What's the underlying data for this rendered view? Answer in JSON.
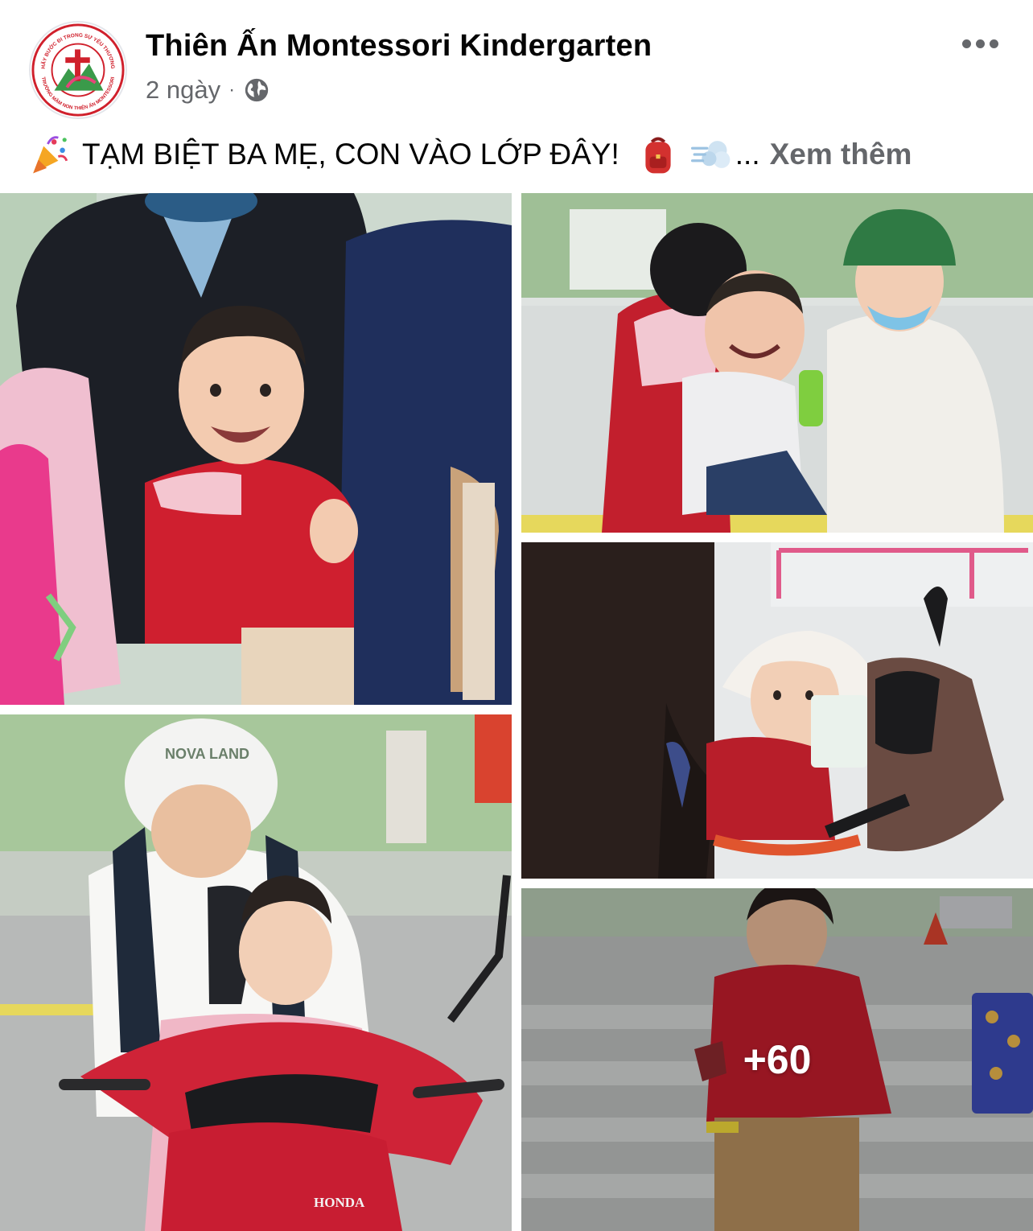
{
  "header": {
    "page_name": "Thiên Ấn Montessori Kindergarten",
    "timestamp": "2 ngày",
    "separator": "·",
    "privacy_icon": "globe-icon",
    "more_icon": "more-options-icon"
  },
  "avatar": {
    "logo_top_text": "HÃY BƯỚC ĐI TRONG SỰ YÊU THƯƠNG",
    "logo_bottom_text": "TRƯỜNG MẦM NON THIÊN ẤN MONTESSORI"
  },
  "caption": {
    "lead_emoji": "party-popper-emoji",
    "text": "TẠM BIỆT BA MẸ, CON VÀO LỚP ĐÂY!",
    "emoji_1": "backpack-emoji",
    "emoji_2": "dash-emoji",
    "ellipsis": "...",
    "see_more": "Xem thêm"
  },
  "photos": {
    "p1_alt": "child-on-motorbike-smiling",
    "p2_alt": "crying-child-with-teacher",
    "p3_alt": "child-in-white-hat-on-scooter",
    "p4_alt": "father-and-son-on-honda",
    "p5_alt": "child-in-red-shirt-crosswalk",
    "p4_helmet_text": "NOVA LAND",
    "p4_bike_brand": "HONDA",
    "more_count": "+60"
  },
  "colors": {
    "name_text": "#050505",
    "meta_text": "#65676b",
    "school_red": "#d0202c",
    "school_green": "#3a9a4a"
  }
}
